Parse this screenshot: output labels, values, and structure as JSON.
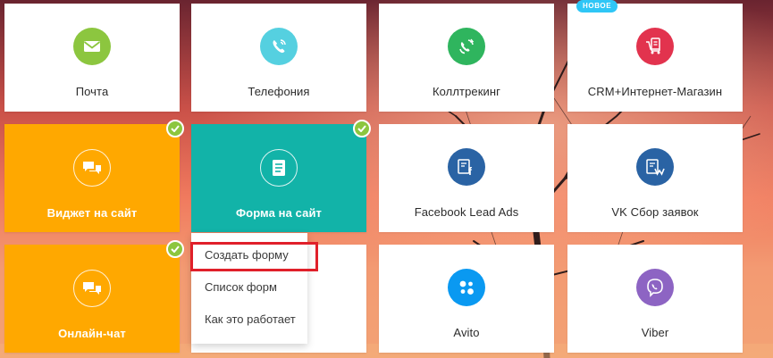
{
  "tiles": [
    {
      "key": "mail",
      "label": "Почта",
      "icon": "envelope-icon",
      "color": "#8cc63f"
    },
    {
      "key": "telephony",
      "label": "Телефония",
      "icon": "phone-icon",
      "color": "#55d0e0"
    },
    {
      "key": "calltracking",
      "label": "Коллтрекинг",
      "icon": "calltracking-icon",
      "color": "#2fb55e"
    },
    {
      "key": "crm_shop",
      "label": "CRM+Интернет-Магазин",
      "icon": "cart-icon",
      "color": "#e2334e",
      "badge": "НОВОЕ"
    },
    {
      "key": "widget",
      "label": "Виджет на сайт",
      "icon": "chat-bubbles-icon",
      "color": "#ffa800",
      "active": true
    },
    {
      "key": "form",
      "label": "Форма на сайт",
      "icon": "document-icon",
      "color": "#12b3a8",
      "active": true
    },
    {
      "key": "facebook",
      "label": "Facebook Lead Ads",
      "icon": "facebook-form-icon",
      "color": "#2a63a4"
    },
    {
      "key": "vk",
      "label": "VK Сбор заявок",
      "icon": "vk-form-icon",
      "color": "#2a63a4"
    },
    {
      "key": "online_chat",
      "label": "Онлайн-чат",
      "icon": "chat-bubbles-icon",
      "color": "#ffa800",
      "active": true
    },
    {
      "key": "avito",
      "label": "Avito",
      "icon": "avito-dots-icon",
      "color": "#0a99f1"
    },
    {
      "key": "viber",
      "label": "Viber",
      "icon": "viber-icon",
      "color": "#8d64c3"
    }
  ],
  "dropdown": {
    "items": [
      "Создать форму",
      "Список форм",
      "Как это работает"
    ],
    "highlighted_index": 0
  },
  "colors": {
    "active_orange": "#ffa800",
    "active_teal": "#12b3a8",
    "check_green": "#8cc63f",
    "highlight_red": "#e0202a"
  }
}
